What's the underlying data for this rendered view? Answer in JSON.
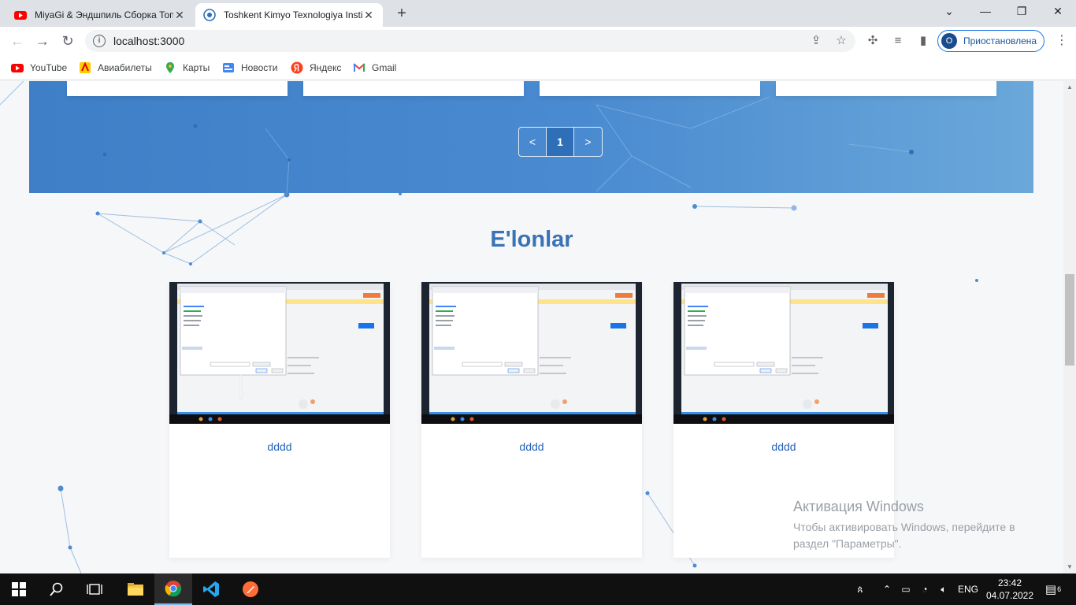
{
  "browser": {
    "tabs": [
      {
        "title": "MiyaGi & Эндшпиль Сборка Топ",
        "active": false
      },
      {
        "title": "Toshkent Kimyo Texnologiya Insti",
        "active": true
      }
    ],
    "url": "localhost:3000",
    "profile_label": "Приостановлена",
    "profile_initial": "О",
    "bookmarks": [
      {
        "label": "YouTube",
        "icon": "youtube-icon"
      },
      {
        "label": "Авиабилеты",
        "icon": "flights-icon"
      },
      {
        "label": "Карты",
        "icon": "maps-icon"
      },
      {
        "label": "Новости",
        "icon": "news-icon"
      },
      {
        "label": "Яндекс",
        "icon": "yandex-icon"
      },
      {
        "label": "Gmail",
        "icon": "gmail-icon"
      }
    ]
  },
  "page": {
    "pagination": {
      "prev": "<",
      "current": "1",
      "next": ">"
    },
    "section_title": "E'lonlar",
    "announcements": [
      {
        "label": "dddd"
      },
      {
        "label": "dddd"
      },
      {
        "label": "dddd"
      }
    ]
  },
  "watermark": {
    "title": "Активация Windows",
    "line1": "Чтобы активировать Windows, перейдите в",
    "line2": "раздел \"Параметры\"."
  },
  "taskbar": {
    "language": "ENG",
    "time": "23:42",
    "date": "04.07.2022",
    "notifications": "6"
  },
  "colors": {
    "hero_blue": "#3e7fc7",
    "title_blue": "#3a73b5",
    "link_blue": "#2563b8",
    "taskbar": "#101010"
  }
}
